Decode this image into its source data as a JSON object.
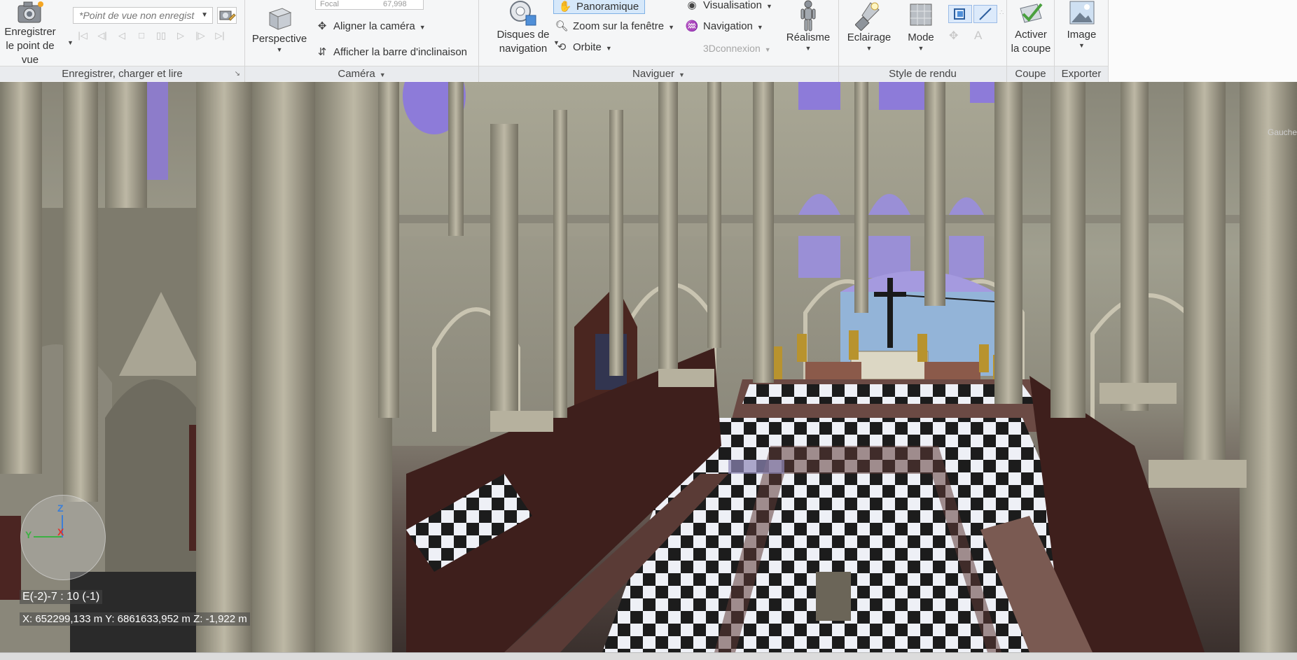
{
  "ribbon": {
    "save_load": {
      "save_viewpoint_line1": "Enregistrer",
      "save_viewpoint_line2": "le point de vue",
      "viewpoint_combo_value": "*Point de vue non enregist",
      "panel_title": "Enregistrer, charger et lire"
    },
    "camera": {
      "focal_label": "Focal",
      "focal_value": "67,998",
      "perspective_label": "Perspective",
      "align_camera_label": "Aligner la caméra",
      "show_tilt_bar_label": "Afficher la barre d'inclinaison",
      "panel_title": "Caméra"
    },
    "navigate": {
      "disks_line1": "Disques de",
      "disks_line2": "navigation",
      "pan_label": "Panoramique",
      "zoom_window_label": "Zoom sur la fenêtre",
      "orbit_label": "Orbite",
      "visualisation_label": "Visualisation",
      "navigation_label": "Navigation",
      "connexion_label": "3Dconnexion",
      "realism_label": "Réalisme",
      "panel_title": "Naviguer"
    },
    "render_style": {
      "lighting_label": "Eclairage",
      "mode_label": "Mode",
      "panel_title": "Style de rendu"
    },
    "section": {
      "activate_line1": "Activer",
      "activate_line2": "la coupe",
      "panel_title": "Coupe"
    },
    "export": {
      "image_label": "Image",
      "panel_title": "Exporter"
    }
  },
  "viewport": {
    "nav_cube_label": "Gauche",
    "gizmo": {
      "z": "Z",
      "y": "Y",
      "x": "X"
    },
    "grid_location": "E(-2)-7 : 10 (-1)",
    "coordinates": "X: 652299,133 m  Y: 6861633,952 m  Z: -1,922 m"
  },
  "colors": {
    "ribbon_bg": "#f5f6f7",
    "active_button": "#d6e8fa",
    "accent_blue": "#3c7fd6"
  }
}
